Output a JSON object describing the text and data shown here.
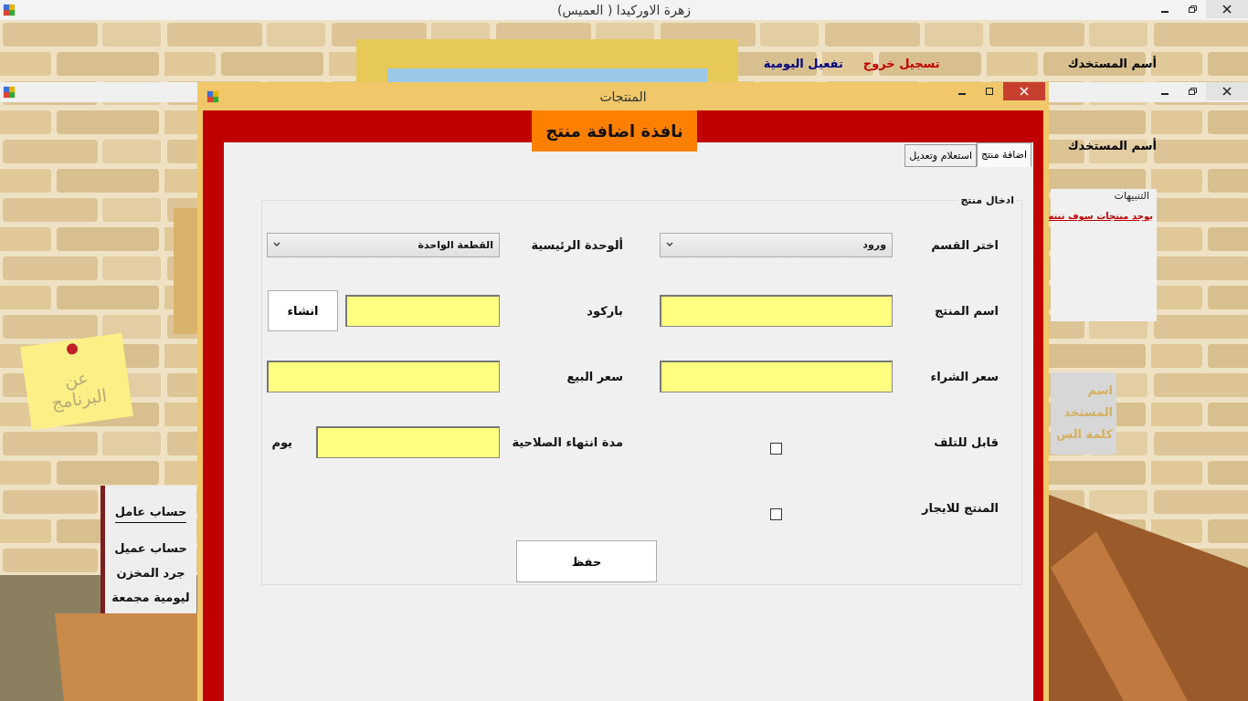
{
  "main_window": {
    "title": "زهرة الاوركيدا ( العميس)"
  },
  "top_menu": [
    {
      "label": "أسم المستخدك",
      "color": "#000000"
    },
    {
      "label": "تسجيل خروج",
      "color": "#c00000"
    },
    {
      "label": "تفعيل اليومية",
      "color": "#000080"
    }
  ],
  "user_label": "أسم المستخدك",
  "notifications": {
    "title": "التنبيهات",
    "link": "يوجد منتجات  سوف تنته"
  },
  "sticky_note": "عن البرنامج",
  "book_menu": [
    {
      "label": "حساب عامل",
      "selected": true
    },
    {
      "label": "حساب عميل",
      "selected": false
    },
    {
      "label": "جرد المخزن",
      "selected": false
    },
    {
      "label": "ليومية مجمعة",
      "selected": false
    }
  ],
  "sign_lines": [
    "اسم",
    "المستخد",
    "كلمة الس"
  ],
  "dialog": {
    "title": "المنتجات",
    "header": "نافذة اضافة منتج",
    "tabs": [
      {
        "label": "اضافة منتج",
        "selected": true
      },
      {
        "label": "استعلام وتعديل",
        "selected": false
      }
    ],
    "group_title": "ادخال منتج",
    "rows": [
      {
        "right": {
          "kind": "select",
          "label": "اختر القسم",
          "value": "ورود"
        },
        "left": {
          "kind": "select",
          "label": "ألوحدة الرئيسية",
          "value": "القطعة الواحدة"
        }
      },
      {
        "right": {
          "kind": "text",
          "label": "اسم  المنتج"
        },
        "left": {
          "kind": "text",
          "label": "باركود",
          "button": "انشاء"
        }
      },
      {
        "right": {
          "kind": "text",
          "label": "سعر الشراء"
        },
        "left": {
          "kind": "text",
          "label": "سعر البيع"
        }
      },
      {
        "right": {
          "kind": "checkbox",
          "label": "قابل للتلف",
          "checked": false
        },
        "left": {
          "kind": "text",
          "label": "مدة انتهاء الصلاحية",
          "unit": "يوم"
        }
      },
      {
        "right": {
          "kind": "checkbox",
          "label": "المنتج للايجار",
          "checked": false
        }
      }
    ],
    "save_button": "حفظ"
  }
}
